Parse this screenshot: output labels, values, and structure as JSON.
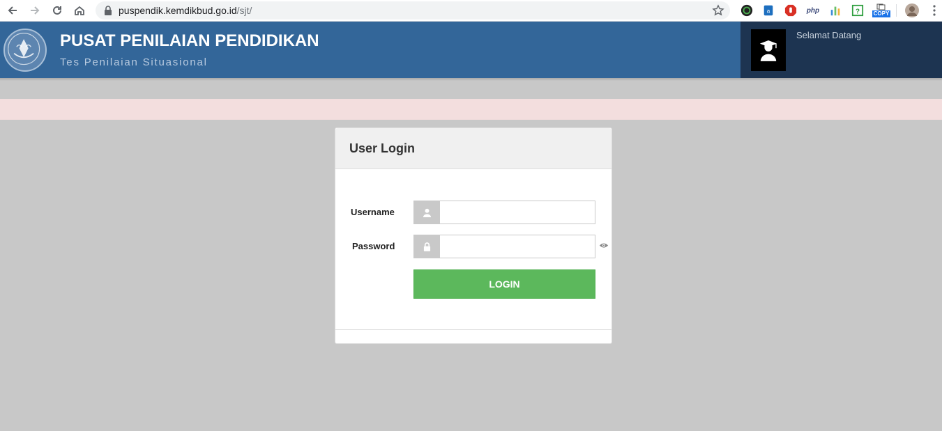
{
  "browser": {
    "url_host": "puspendik.kemdikbud.go.id",
    "url_path": "/sjt/",
    "extensions": [
      "color-picker-icon",
      "dictionary-icon",
      "adblock-icon",
      "php-icon",
      "analytics-icon",
      "help-icon",
      "copy-icon",
      "profile-avatar-icon"
    ],
    "ext_php_label": "php",
    "ext_copy_label": "COPY"
  },
  "header": {
    "title": "PUSAT PENILAIAN PENDIDIKAN",
    "subtitle": "Tes Penilaian Situasional",
    "welcome": "Selamat Datang"
  },
  "login": {
    "title": "User Login",
    "username_label": "Username",
    "username_value": "",
    "password_label": "Password",
    "password_value": "",
    "button_label": "LOGIN"
  },
  "colors": {
    "header_bg": "#336699",
    "user_panel_bg": "#1d3451",
    "page_bg": "#c8c8c8",
    "alert_bg": "#f3dede",
    "login_button": "#5cb85c"
  }
}
